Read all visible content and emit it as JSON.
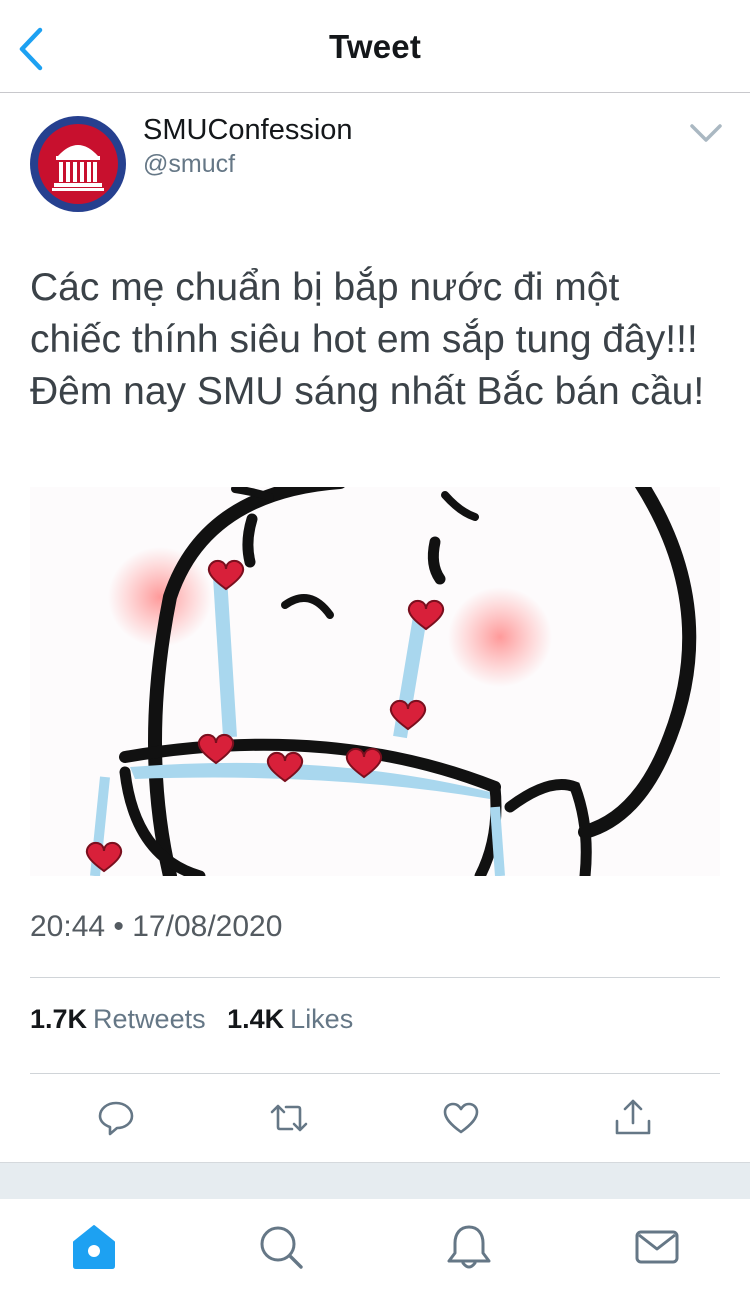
{
  "colors": {
    "accent": "#1da1f2",
    "icon_gray": "#657786",
    "text_primary": "#14171a",
    "avatar_ring": "#26408f",
    "avatar_fill": "#c8102e"
  },
  "header": {
    "title": "Tweet",
    "back_icon": "chevron-left-icon"
  },
  "author": {
    "name": "SMUConfession",
    "handle": "@smucf",
    "avatar_icon": "building-columns-icon",
    "menu_icon": "chevron-down-icon"
  },
  "tweet": {
    "text": "Các mẹ chuẩn bị bắp nước đi một chiếc thính siêu hot em sắp tung đây!!! Đêm nay SMU sáng nhất Bắc bán cầu!",
    "media_icon": "crying-hearts-meme-image",
    "timestamp": "20:44 • 17/08/2020"
  },
  "stats": {
    "retweets_count": "1.7K",
    "retweets_label": "Retweets",
    "likes_count": "1.4K",
    "likes_label": "Likes"
  },
  "actions": [
    "reply-icon",
    "retweet-icon",
    "like-icon",
    "share-icon"
  ],
  "tabbar": {
    "active": "home",
    "items": [
      "home-icon",
      "search-icon",
      "notifications-icon",
      "messages-icon"
    ]
  }
}
